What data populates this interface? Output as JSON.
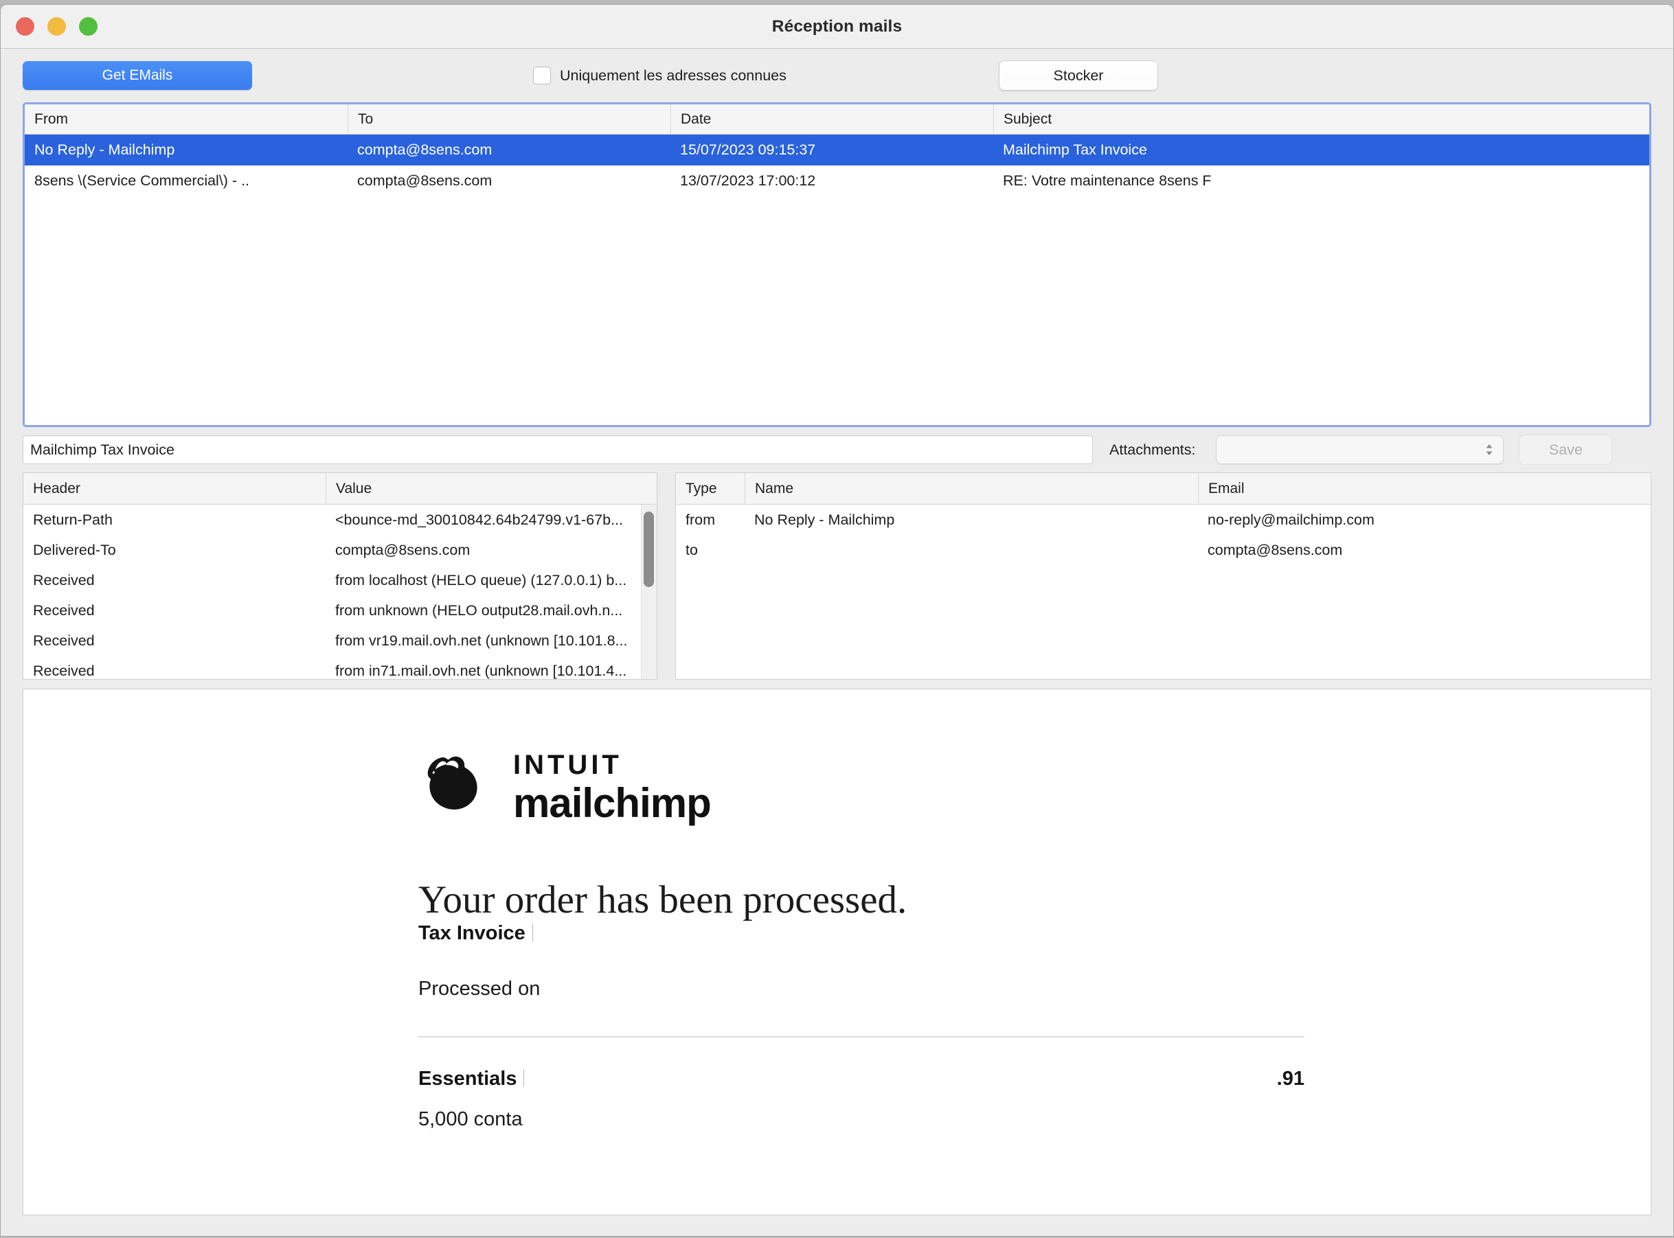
{
  "window": {
    "title": "Réception mails",
    "traffic_lights": [
      "close",
      "minimize",
      "maximize"
    ]
  },
  "toolbar": {
    "get_emails_label": "Get EMails",
    "known_addresses_label": "Uniquement les adresses connues",
    "known_addresses_checked": false,
    "stocker_label": "Stocker"
  },
  "mail_list": {
    "columns": [
      "From",
      "To",
      "Date",
      "Subject"
    ],
    "rows": [
      {
        "from": "No Reply - Mailchimp",
        "to": "compta@8sens.com",
        "date": "15/07/2023 09:15:37",
        "subject": "Mailchimp Tax Invoice",
        "selected": true
      },
      {
        "from": "8sens \\(Service Commercial\\) -            ..",
        "to": "compta@8sens.com",
        "date": "13/07/2023 17:00:12",
        "subject": "RE: Votre maintenance 8sens F",
        "selected": false
      }
    ]
  },
  "subject_bar": {
    "subject_value": "Mailchimp Tax Invoice",
    "subject_placeholder": "",
    "attachments_label": "Attachments:",
    "attachments_selected": "",
    "save_label": "Save",
    "save_enabled": false
  },
  "headers_table": {
    "columns": [
      "Header",
      "Value"
    ],
    "rows": [
      {
        "header": "Return-Path",
        "value": "<bounce-md_30010842.64b24799.v1-67b..."
      },
      {
        "header": "Delivered-To",
        "value": "compta@8sens.com"
      },
      {
        "header": "Received",
        "value": "from localhost (HELO queue) (127.0.0.1) b..."
      },
      {
        "header": "Received",
        "value": "from unknown (HELO output28.mail.ovh.n..."
      },
      {
        "header": "Received",
        "value": "from vr19.mail.ovh.net (unknown [10.101.8..."
      },
      {
        "header": "Received",
        "value": "from in71.mail.ovh.net (unknown [10.101.4..."
      }
    ]
  },
  "addresses_table": {
    "columns": [
      "Type",
      "Name",
      "Email"
    ],
    "rows": [
      {
        "type": "from",
        "name": "No Reply - Mailchimp",
        "email": "no-reply@mailchimp.com"
      },
      {
        "type": "to",
        "name": "",
        "email": "compta@8sens.com"
      }
    ]
  },
  "preview": {
    "logo_brand": "INTUIT",
    "logo_product": "mailchimp",
    "logo_icon": "mailchimp-freddie-icon",
    "heading": "Your order has been processed.",
    "invoice_label": "Tax Invoice",
    "processed_label": "Processed on",
    "plan_name": "Essentials",
    "plan_price": ".91",
    "plan_detail": "5,000 conta"
  },
  "colors": {
    "accent_blue": "#3a7df0",
    "selection_blue": "#2a62dd",
    "focus_ring": "#8ca5e8",
    "window_bg": "#ececec"
  }
}
